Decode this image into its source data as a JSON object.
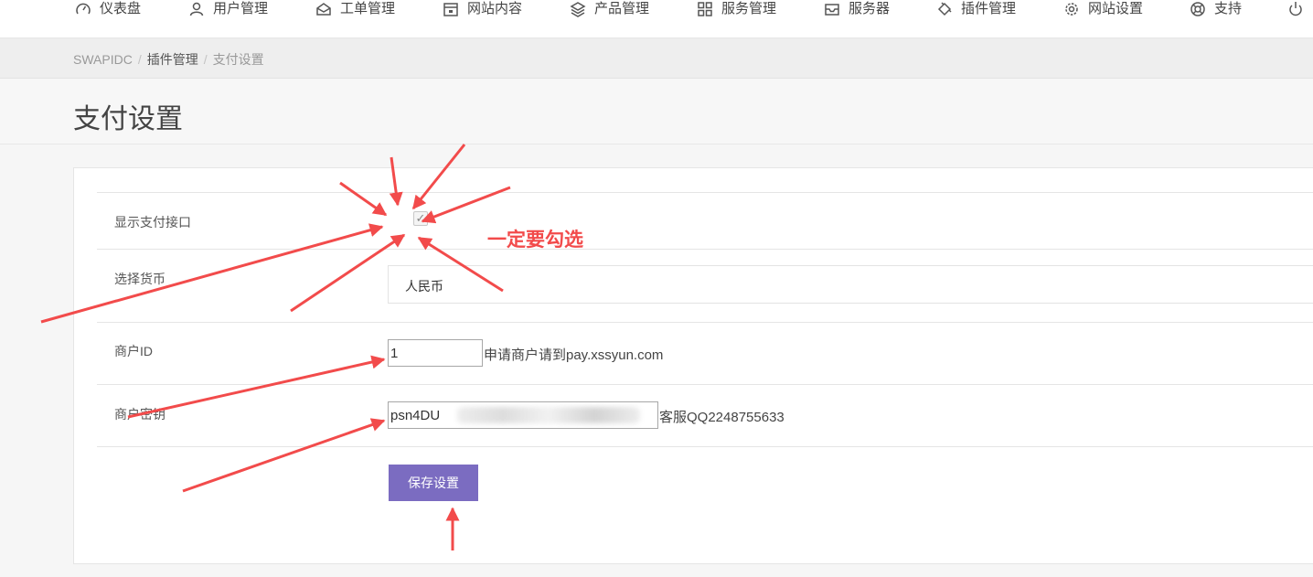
{
  "nav": {
    "items": [
      {
        "label": "仪表盘",
        "icon": "dashboard-icon"
      },
      {
        "label": "用户管理",
        "icon": "user-icon"
      },
      {
        "label": "工单管理",
        "icon": "envelope-icon"
      },
      {
        "label": "网站内容",
        "icon": "calendar-icon"
      },
      {
        "label": "产品管理",
        "icon": "layers-icon"
      },
      {
        "label": "服务管理",
        "icon": "grid-icon"
      },
      {
        "label": "服务器",
        "icon": "inbox-icon"
      },
      {
        "label": "插件管理",
        "icon": "plug-icon"
      },
      {
        "label": "网站设置",
        "icon": "gear-icon"
      },
      {
        "label": "支持",
        "icon": "lifebuoy-icon"
      }
    ],
    "power_icon": "power-icon"
  },
  "breadcrumb": {
    "items": [
      "SWAPIDC",
      "插件管理",
      "支付设置"
    ],
    "separator": "/"
  },
  "page": {
    "title": "支付设置"
  },
  "form": {
    "show_payment": {
      "label": "显示支付接口",
      "checked": true,
      "check_glyph": "✓"
    },
    "currency": {
      "label": "选择货币",
      "selected": "人民币"
    },
    "merchant_id": {
      "label": "商户ID",
      "value": "1",
      "hint": "申请商户请到pay.xssyun.com"
    },
    "merchant_key": {
      "label": "商户密钥",
      "value": "psn4DU",
      "hint": "客服QQ2248755633"
    },
    "save_label": "保存设置"
  },
  "annotation": {
    "text": "一定要勾选",
    "color": "#f24b4b"
  },
  "colors": {
    "accent": "#7b6cc1",
    "annotation": "#f24b4b"
  }
}
